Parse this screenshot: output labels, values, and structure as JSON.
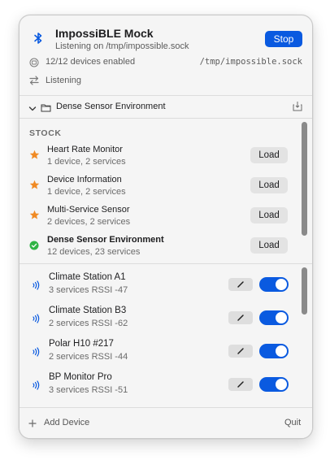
{
  "header": {
    "app_title": "ImpossiBLE Mock",
    "listening_line": "Listening on /tmp/impossible.sock",
    "stop_label": "Stop",
    "devices_enabled": "12/12 devices enabled",
    "socket_path": "/tmp/impossible.sock",
    "status_label": "Listening"
  },
  "environment": {
    "name": "Dense Sensor Environment"
  },
  "stock": {
    "section_label": "STOCK",
    "items": [
      {
        "title": "Heart Rate Monitor",
        "detail": "1 device, 2 services",
        "load_label": "Load",
        "icon": "star-icon"
      },
      {
        "title": "Device Information",
        "detail": "1 device, 2 services",
        "load_label": "Load",
        "icon": "star-icon"
      },
      {
        "title": "Multi-Service Sensor",
        "detail": "2 devices, 2 services",
        "load_label": "Load",
        "icon": "star-icon"
      },
      {
        "title": "Dense Sensor Environment",
        "detail": "12 devices, 23 services",
        "load_label": "Load",
        "icon": "checkmark-circle-icon"
      }
    ]
  },
  "devices": [
    {
      "name": "Climate Station A1",
      "detail": "3 services  RSSI -47",
      "enabled": true
    },
    {
      "name": "Climate Station B3",
      "detail": "2 services  RSSI -62",
      "enabled": true
    },
    {
      "name": "Polar H10 #217",
      "detail": "2 services  RSSI -44",
      "enabled": true
    },
    {
      "name": "BP Monitor Pro",
      "detail": "3 services  RSSI -51",
      "enabled": true
    }
  ],
  "footer": {
    "add_device_label": "Add Device",
    "quit_label": "Quit"
  },
  "colors": {
    "accent": "#0a5ae0",
    "star": "#f08a24",
    "check": "#2fb344"
  }
}
